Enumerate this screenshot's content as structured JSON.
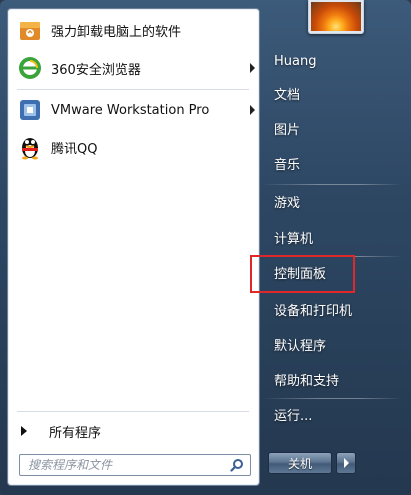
{
  "programs": [
    {
      "label": "强力卸载电脑上的软件",
      "icon": "uninstaller-icon",
      "has_submenu": false
    },
    {
      "label": "360安全浏览器",
      "icon": "browser-360-icon",
      "has_submenu": true
    },
    {
      "label": "VMware Workstation Pro",
      "icon": "vmware-icon",
      "has_submenu": true
    },
    {
      "label": "腾讯QQ",
      "icon": "qq-penguin-icon",
      "has_submenu": false
    }
  ],
  "all_programs_label": "所有程序",
  "search": {
    "placeholder": "搜索程序和文件"
  },
  "user_name": "Huang",
  "right_items": {
    "documents": "文档",
    "pictures": "图片",
    "music": "音乐",
    "games": "游戏",
    "computer": "计算机",
    "control_panel": "控制面板",
    "devices_printers": "设备和打印机",
    "default_programs": "默认程序",
    "help_support": "帮助和支持",
    "run": "运行..."
  },
  "shutdown_label": "关机",
  "colors": {
    "highlight_box": "#e0282a",
    "pane_background": "#2d4763",
    "left_background": "#ffffff"
  }
}
